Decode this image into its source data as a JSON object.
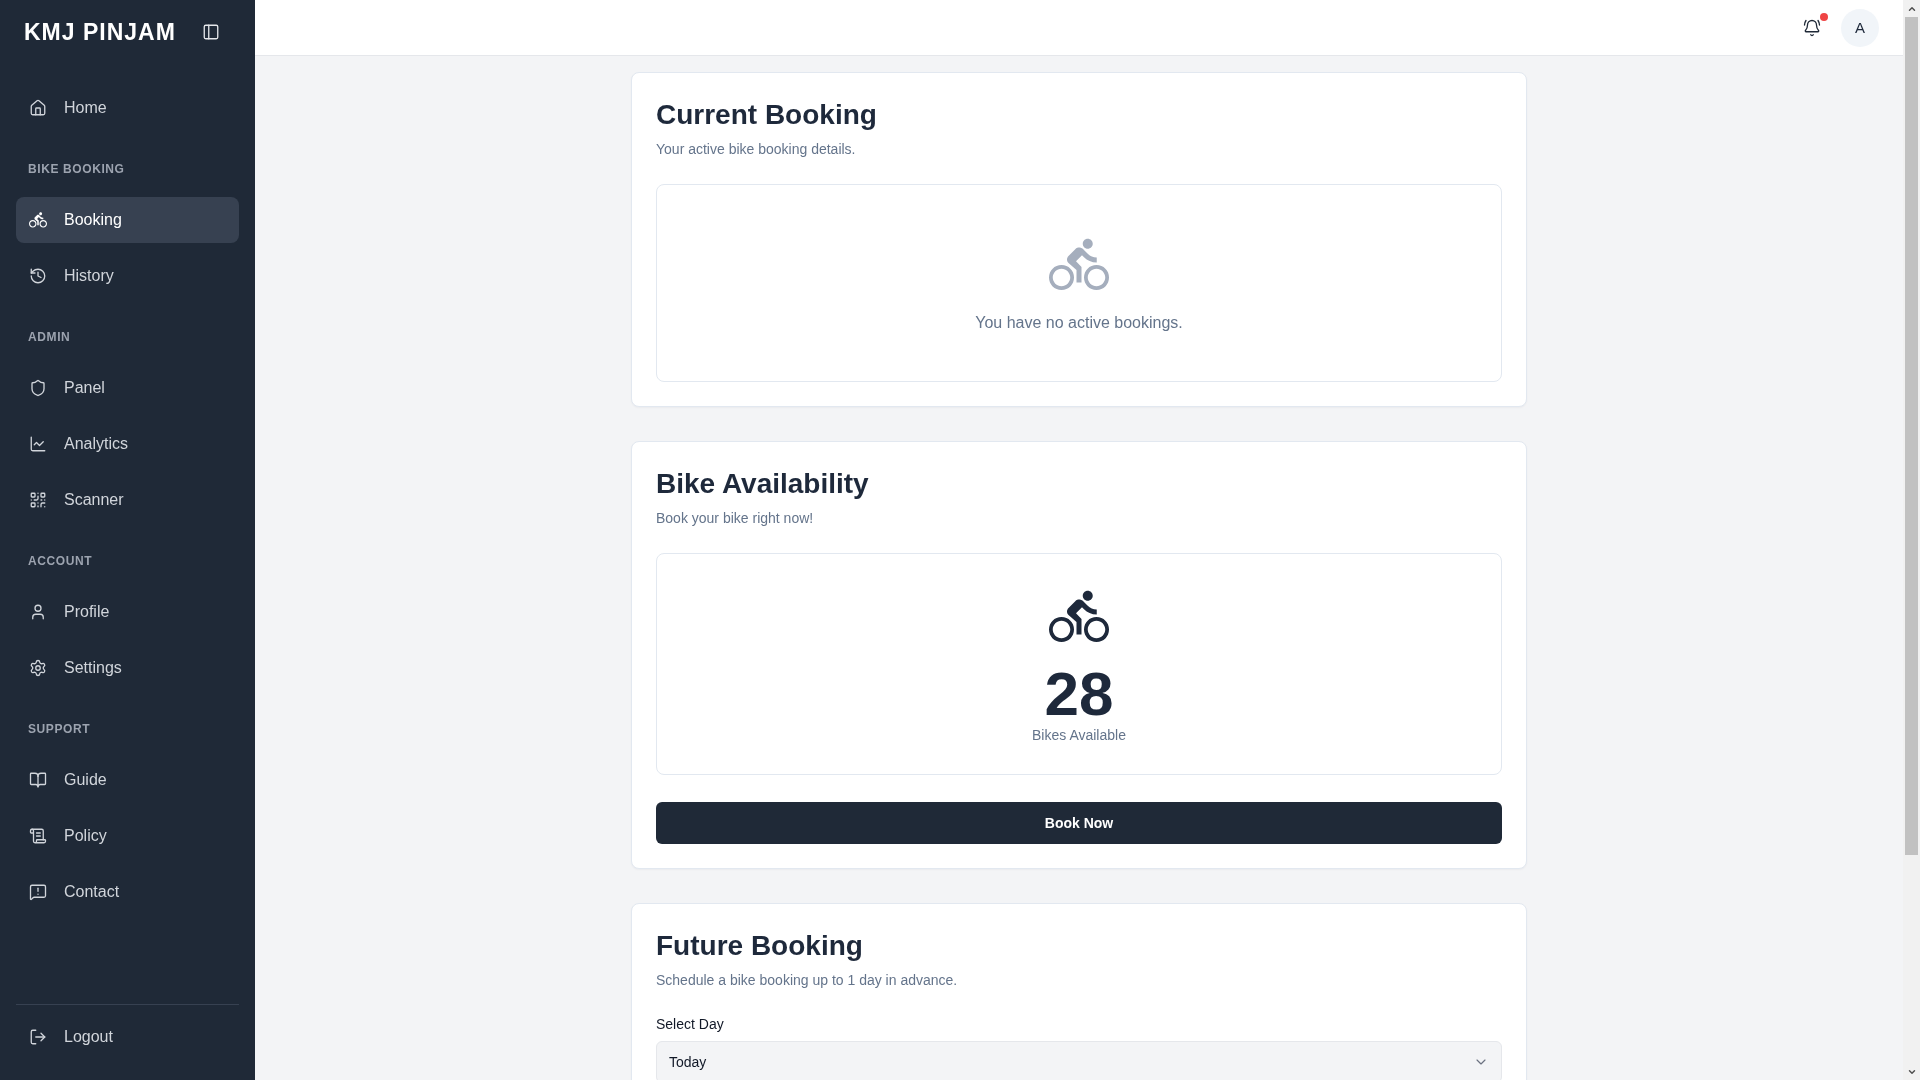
{
  "sidebar": {
    "logo": "KMJ PINJAM",
    "sections": [
      {
        "items": [
          {
            "label": "Home",
            "selected": false
          }
        ]
      },
      {
        "heading": "BIKE BOOKING",
        "items": [
          {
            "label": "Booking",
            "selected": true
          },
          {
            "label": "History",
            "selected": false
          }
        ]
      },
      {
        "heading": "ADMIN",
        "items": [
          {
            "label": "Panel",
            "selected": false
          },
          {
            "label": "Analytics",
            "selected": false
          },
          {
            "label": "Scanner",
            "selected": false
          }
        ]
      },
      {
        "heading": "ACCOUNT",
        "items": [
          {
            "label": "Profile",
            "selected": false
          },
          {
            "label": "Settings",
            "selected": false
          }
        ]
      },
      {
        "heading": "SUPPORT",
        "items": [
          {
            "label": "Guide",
            "selected": false
          },
          {
            "label": "Policy",
            "selected": false
          },
          {
            "label": "Contact",
            "selected": false
          }
        ]
      }
    ],
    "logout": {
      "label": "Logout"
    }
  },
  "header": {
    "notifications": {
      "unread": true
    },
    "avatar": {
      "initial": "A"
    }
  },
  "current_booking": {
    "title": "Current Booking",
    "subtitle": "Your active bike booking details.",
    "empty_message": "You have no active bookings."
  },
  "bike_availability": {
    "title": "Bike Availability",
    "subtitle": "Book your bike right now!",
    "count": "28",
    "count_label": "Bikes Available",
    "button": "Book Now"
  },
  "future_booking": {
    "title": "Future Booking",
    "subtitle": "Schedule a bike booking up to 1 day in advance.",
    "field_label": "Select Day",
    "value": "Today"
  }
}
